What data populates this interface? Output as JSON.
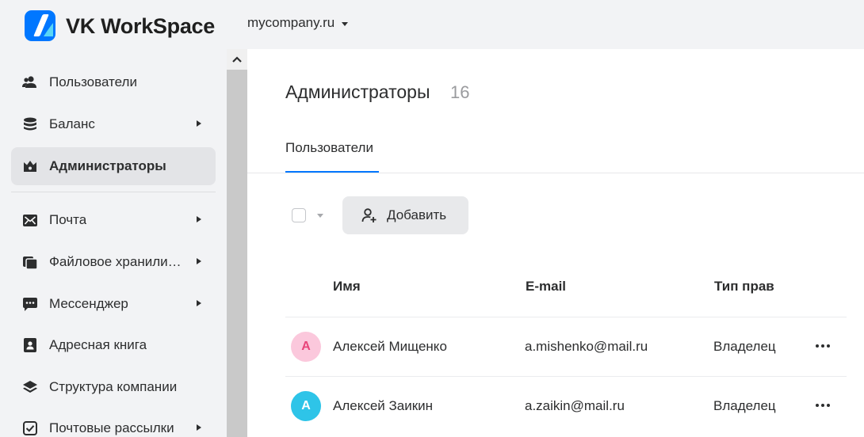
{
  "header": {
    "brand": "VK WorkSpace",
    "domain": "mycompany.ru"
  },
  "sidebar": {
    "items": [
      {
        "label": "Пользователи",
        "icon": "users-icon",
        "has_submenu": false,
        "active": false
      },
      {
        "label": "Баланс",
        "icon": "database-icon",
        "has_submenu": true,
        "active": false
      },
      {
        "label": "Администраторы",
        "icon": "crown-icon",
        "has_submenu": false,
        "active": true
      },
      {
        "label": "Почта",
        "icon": "mail-icon",
        "has_submenu": true,
        "active": false
      },
      {
        "label": "Файловое хранили…",
        "icon": "folder-icon",
        "has_submenu": true,
        "active": false
      },
      {
        "label": "Мессенджер",
        "icon": "message-icon",
        "has_submenu": true,
        "active": false
      },
      {
        "label": "Адресная книга",
        "icon": "address-book-icon",
        "has_submenu": false,
        "active": false
      },
      {
        "label": "Структура компании",
        "icon": "layers-icon",
        "has_submenu": false,
        "active": false
      },
      {
        "label": "Почтовые рассылки",
        "icon": "checkbox-icon",
        "has_submenu": true,
        "active": false
      }
    ]
  },
  "main": {
    "title": "Администраторы",
    "count": "16",
    "tabs": [
      {
        "label": "Пользователи",
        "active": true
      }
    ],
    "add_button": "Добавить",
    "columns": {
      "name": "Имя",
      "email": "E-mail",
      "rights": "Тип прав"
    },
    "rows": [
      {
        "initial": "А",
        "name": "Алексей Мищенко",
        "email": "a.mishenko@mail.ru",
        "rights": "Владелец",
        "avatar_bg": "#fbc8dc",
        "avatar_fg": "#e8457a"
      },
      {
        "initial": "А",
        "name": "Алексей Заикин",
        "email": "a.zaikin@mail.ru",
        "rights": "Владелец",
        "avatar_bg": "#2ec4e8",
        "avatar_fg": "#ffffff"
      }
    ]
  },
  "colors": {
    "accent": "#0077ff",
    "active_nav_bg": "#e3e4e7",
    "page_bg": "#f2f3f5"
  }
}
